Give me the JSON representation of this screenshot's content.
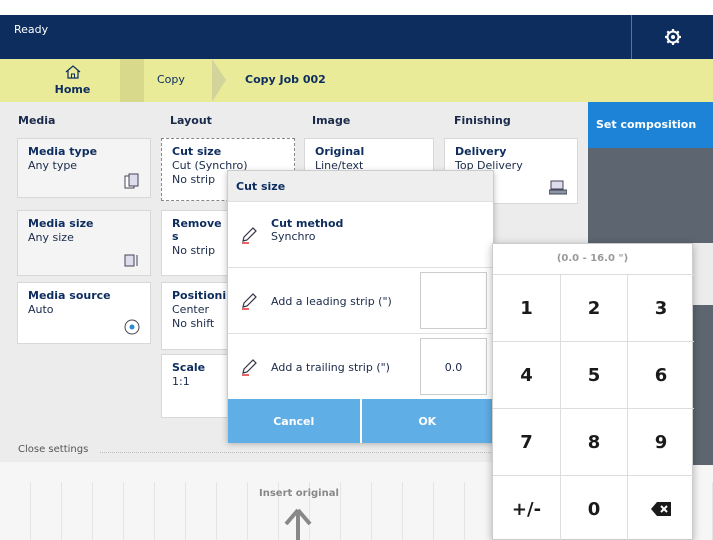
{
  "topbar": {
    "status": "Ready"
  },
  "breadcrumb": {
    "home": "Home",
    "copy": "Copy",
    "job": "Copy Job 002"
  },
  "columns": {
    "media": "Media",
    "layout": "Layout",
    "image": "Image",
    "finishing": "Finishing"
  },
  "set_composition": "Set composition",
  "tiles": {
    "media_type": {
      "title": "Media type",
      "value": "Any type"
    },
    "media_size": {
      "title": "Media size",
      "value": "Any size"
    },
    "media_source": {
      "title": "Media source",
      "value": "Auto"
    },
    "cut_size": {
      "title": "Cut size",
      "value1": "Cut (Synchro)",
      "value2": "No strip"
    },
    "remove": {
      "title": "Remove s",
      "value": "No strip"
    },
    "positioning": {
      "title": "Positionin",
      "value1": "Center",
      "value2": "No shift"
    },
    "scale": {
      "title": "Scale",
      "value": "1:1"
    },
    "original": {
      "title": "Original",
      "value": "Line/text"
    },
    "delivery": {
      "title": "Delivery",
      "value": "Top Delivery"
    }
  },
  "close_settings": "Close settings",
  "insert_original": "Insert original",
  "dialog": {
    "title": "Cut size",
    "cut_method_title": "Cut method",
    "cut_method_value": "Synchro",
    "leading_label": "Add a leading strip (\")",
    "leading_value": "",
    "trailing_label": "Add a trailing strip (\")",
    "trailing_value": "0.0",
    "cancel": "Cancel",
    "ok": "OK"
  },
  "keypad": {
    "range": "(0.0 - 16.0 \")",
    "keys": [
      "1",
      "2",
      "3",
      "4",
      "5",
      "6",
      "7",
      "8",
      "9",
      "+/-",
      "0"
    ]
  }
}
